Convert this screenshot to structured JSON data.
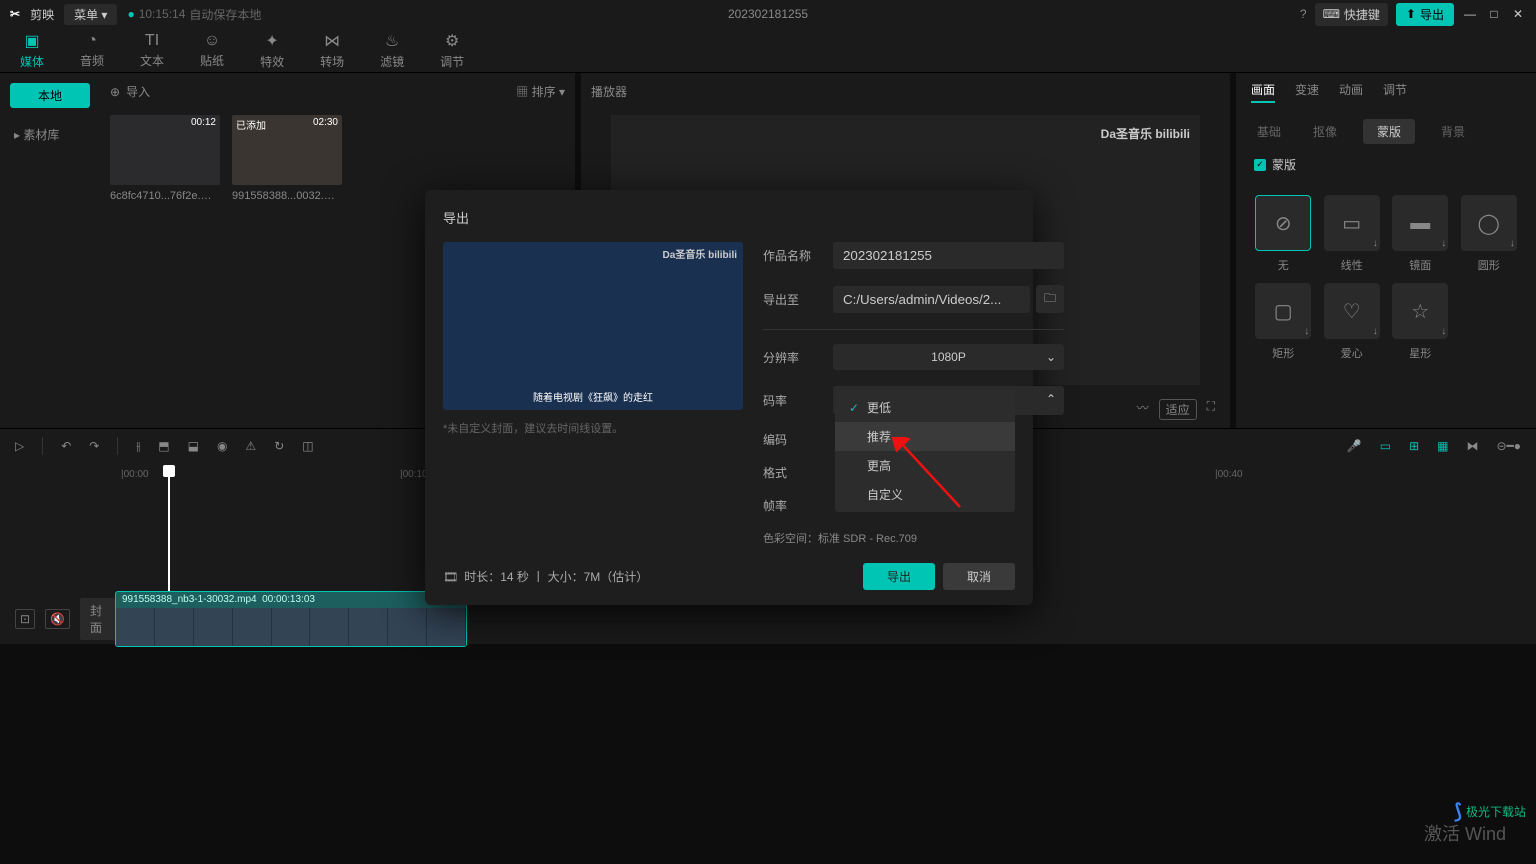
{
  "titlebar": {
    "app": "剪映",
    "menu": "菜单 ▾",
    "autosave_time": "10:15:14",
    "autosave_text": "自动保存本地",
    "project": "202302181255",
    "shortcut": "快捷键",
    "export": "导出"
  },
  "topnav": {
    "media": "媒体",
    "audio": "音频",
    "text": "文本",
    "sticker": "贴纸",
    "effect": "特效",
    "transition": "转场",
    "filter": "滤镜",
    "adjust": "调节"
  },
  "side": {
    "local": "本地",
    "library": "素材库"
  },
  "media": {
    "import": "导入",
    "sort": "排序 ▾",
    "clip1": {
      "dur": "00:12",
      "name": "6c8fc4710...76f2e.mp4"
    },
    "clip2": {
      "badge": "已添加",
      "dur": "02:30",
      "name": "991558388...0032.mp4"
    }
  },
  "player": {
    "title": "播放器",
    "overlay": "Da圣音乐   bilibili",
    "fit": "适应"
  },
  "right": {
    "tab1": "画面",
    "tab2": "变速",
    "tab3": "动画",
    "tab4": "调节",
    "sub1": "基础",
    "sub2": "抠像",
    "sub3": "蒙版",
    "sub4": "背景",
    "check": "蒙版",
    "m1": "无",
    "m2": "线性",
    "m3": "镜面",
    "m4": "圆形",
    "m5": "矩形",
    "m6": "爱心",
    "m7": "星形"
  },
  "track": {
    "cover": "封面",
    "clip_name": "991558388_nb3-1-30032.mp4",
    "clip_time": "00:00:13:03",
    "t1": "|00:00",
    "t2": "|00:10",
    "t3": "|00:40"
  },
  "modal": {
    "title": "导出",
    "preview_overlay": "Da圣音乐  bilibili",
    "preview_sub": "随着电视剧《狂飙》的走红",
    "hint": "*未自定义封面，建议去时间线设置。",
    "name_lbl": "作品名称",
    "name_val": "202302181255",
    "path_lbl": "导出至",
    "path_val": "C:/Users/admin/Videos/2...",
    "res_lbl": "分辨率",
    "res_val": "1080P",
    "rate_lbl": "码率",
    "rate_val": "更低",
    "enc_lbl": "编码",
    "fmt_lbl": "格式",
    "fps_lbl": "帧率",
    "opt1": "更低",
    "opt2": "推荐",
    "opt3": "更高",
    "opt4": "自定义",
    "colorspace": "色彩空间：标准 SDR - Rec.709",
    "dur_info": "时长：14 秒 丨 大小：7M（估计）",
    "export_btn": "导出",
    "cancel_btn": "取消"
  },
  "watermark": {
    "site": "极光下载站"
  },
  "activate": "激活 Wind"
}
